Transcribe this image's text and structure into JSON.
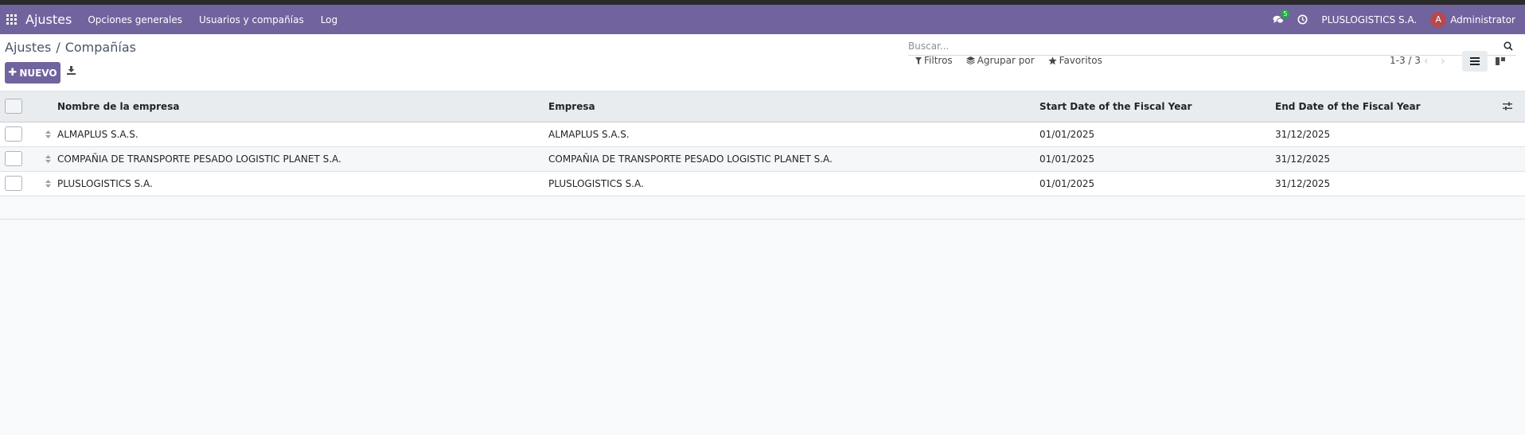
{
  "navbar": {
    "app_name": "Ajustes",
    "menus": [
      "Opciones generales",
      "Usuarios y compañías",
      "Log"
    ],
    "messages_count": "5",
    "company": "PLUSLOGISTICS S.A.",
    "avatar_letter": "A",
    "user": "Administrator"
  },
  "breadcrumb": {
    "parent": "Ajustes",
    "separator": "/",
    "current": "Compañías"
  },
  "toolbar": {
    "new_label": "NUEVO"
  },
  "search": {
    "placeholder": "Buscar...",
    "value": ""
  },
  "filters": {
    "filters_label": "Filtros",
    "groupby_label": "Agrupar por",
    "favorites_label": "Favoritos"
  },
  "pager": {
    "range": "1-3 / 3"
  },
  "table": {
    "columns": [
      "Nombre de la empresa",
      "Empresa",
      "Start Date of the Fiscal Year",
      "End Date of the Fiscal Year"
    ],
    "rows": [
      [
        "ALMAPLUS S.A.S.",
        "ALMAPLUS S.A.S.",
        "01/01/2025",
        "31/12/2025"
      ],
      [
        "COMPAÑIA DE TRANSPORTE PESADO LOGISTIC PLANET S.A.",
        "COMPAÑIA DE TRANSPORTE PESADO LOGISTIC PLANET S.A.",
        "01/01/2025",
        "31/12/2025"
      ],
      [
        "PLUSLOGISTICS S.A.",
        "PLUSLOGISTICS S.A.",
        "01/01/2025",
        "31/12/2025"
      ]
    ]
  },
  "colors": {
    "brand": "#71639e",
    "badge": "#28a745",
    "avatar": "#b5494e"
  },
  "icons": [
    "apps-grid-icon",
    "chat-icon",
    "clock-icon",
    "download-icon",
    "search-icon",
    "filter-icon",
    "layers-icon",
    "star-icon",
    "chevron-left-icon",
    "chevron-right-icon",
    "list-view-icon",
    "kanban-view-icon",
    "sliders-icon",
    "drag-handle-icon"
  ]
}
